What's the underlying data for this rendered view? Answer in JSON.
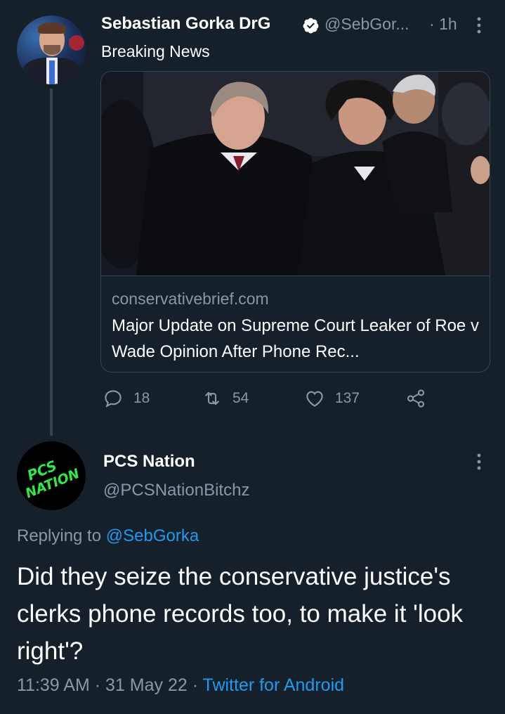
{
  "tweet": {
    "author_name": "Sebastian Gorka DrG",
    "author_handle": "@SebGor...",
    "time_sep": "·",
    "time_ago": "1h",
    "text": "Breaking News",
    "card": {
      "domain": "conservativebrief.com",
      "title": "Major Update on Supreme Court Leaker of Roe v Wade Opinion After Phone Rec..."
    },
    "actions": {
      "replies": "18",
      "retweets": "54",
      "likes": "137"
    },
    "icons": [
      "verified-badge-icon",
      "more-icon",
      "reply-icon",
      "retweet-icon",
      "like-icon",
      "share-icon"
    ]
  },
  "reply": {
    "author_name": "PCS Nation",
    "author_handle": "@PCSNationBitchz",
    "avatar_text_1": "PCS",
    "avatar_text_2": "NATION",
    "replying_label": "Replying to",
    "replying_to": "@SebGorka",
    "text": "Did they seize the conservative justice's clerks phone records too, to make it 'look right'?",
    "time": "11:39 AM",
    "sep1": "·",
    "date": "31 May 22",
    "sep2": "·",
    "source": "Twitter for Android"
  },
  "colors": {
    "background": "#15202b",
    "secondary_text": "#8899a6",
    "accent": "#1d9bf0",
    "divider": "#38444d",
    "avatar_logo_green": "#2ee84a"
  }
}
